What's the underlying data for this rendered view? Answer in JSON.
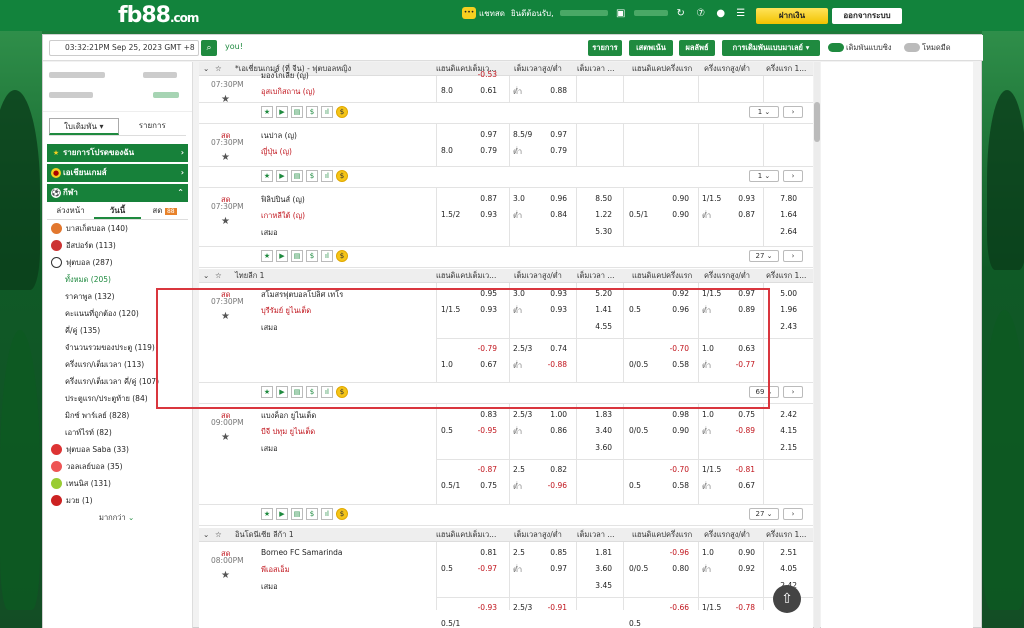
{
  "header": {
    "logo": "fb88",
    "logo_suffix": ".com",
    "chat_label": "แชทสด",
    "welcome": "ยินดีต้อนรับ,",
    "deposit_label": "ฝากเงิน",
    "logout_label": "ออกจากระบบ"
  },
  "toolbar": {
    "datetime": "03:32:21PM Sep 25, 2023 GMT +8",
    "search_text": "you!",
    "btn_items": "รายการ",
    "btn_hot": "เสตพเน้น",
    "btn_results": "ผลลัพธ์",
    "btn_type": "การเดิมพันแบบมาเลย์",
    "toggle1_label": "เดิมพันแบบซิง",
    "toggle2_label": "โหมดมืด"
  },
  "sidebar": {
    "tab_betslip": "ใบเดิมพัน",
    "tab_list": "รายการ",
    "sections": [
      {
        "label": "รายการโปรดของฉัน"
      },
      {
        "label": "เอเชียนเกมส์"
      },
      {
        "label": "กีฬา"
      }
    ],
    "subtabs": [
      "ล่วงหน้า",
      "วันนี้",
      "สด"
    ],
    "live_badge": "88",
    "sports": [
      {
        "label": "บาสเก็ตบอล",
        "count": "(140)"
      },
      {
        "label": "อีสปอร์ต",
        "count": "(113)"
      },
      {
        "label": "ฟุตบอล",
        "count": "(287)"
      }
    ],
    "football_sub": [
      {
        "label": "ทั้งหมด",
        "count": "(205)"
      },
      {
        "label": "ราคาพูล",
        "count": "(132)"
      },
      {
        "label": "คะแนนที่ถูกต้อง",
        "count": "(120)"
      },
      {
        "label": "คี่/คู่",
        "count": "(135)"
      },
      {
        "label": "จำนวนรวมของประตู",
        "count": "(119)"
      },
      {
        "label": "ครึ่งแรก/เต็มเวลา",
        "count": "(113)"
      },
      {
        "label": "ครึ่งแรก/เต็มเวลา คี่/คู่",
        "count": "(107)"
      },
      {
        "label": "ประตูแรก/ประตูท้าย",
        "count": "(84)"
      },
      {
        "label": "มิกซ์ พาร์เลย์",
        "count": "(828)"
      },
      {
        "label": "เอาท์ไรท์",
        "count": "(82)"
      }
    ],
    "others": [
      {
        "label": "ฟุตบอล Saba",
        "count": "(33)"
      },
      {
        "label": "วอลเลย์บอล",
        "count": "(35)"
      },
      {
        "label": "เทนนิส",
        "count": "(131)"
      },
      {
        "label": "มวย",
        "count": "(1)"
      }
    ],
    "more": "มากกว่า"
  },
  "columns": [
    "แฮนดิแคปเต็มเว...",
    "เต็มเวลาสูง/ต่ำ",
    "เต็มเวลา ...",
    "แฮนดิแคปครึ่งแรก",
    "ครึ่งแรกสูง/ต่ำ",
    "ครึ่งแรก 1..."
  ],
  "league1": "*เอเชี่ยนเกมส์ (ที่ จีน) - ฟุตบอลหญิง",
  "league2": "ไทยลีก 1",
  "league3": "อินโดนีเซีย ลีก้า 1",
  "matches": [
    {
      "time": "07:30PM",
      "live": "",
      "home": "มองโกเลีย (ญ)",
      "away": "อุสเบกิสถาน (ญ)",
      "hdp": "8.0",
      "o1": "-0.53",
      "o2": "0.61",
      "ou_label": "ต่ำ",
      "ou2": "0.88",
      "more": "1"
    },
    {
      "time": "07:30PM",
      "live": "สด",
      "home": "เนปาล (ญ)",
      "away": "ญี่ปุ่น (ญ)",
      "hdp": "8.0",
      "o1": "0.97",
      "o2": "0.79",
      "ou": "8.5/9",
      "ou1": "0.97",
      "ou_label": "ต่ำ",
      "ou2": "0.79",
      "more": "1"
    },
    {
      "time": "07:30PM",
      "live": "สด",
      "home": "ฟิลิปปินส์ (ญ)",
      "away": "เกาหลีใต้ (ญ)",
      "draw": "เสมอ",
      "hdp": "1.5/2",
      "o1": "0.87",
      "o2": "0.93",
      "ou": "3.0",
      "ou1": "0.96",
      "ou_label": "ต่ำ",
      "ou2": "0.84",
      "x1": "8.50",
      "x2": "1.22",
      "x3": "5.30",
      "h_hdp": "0.5/1",
      "h1": "0.90",
      "h2": "0.90",
      "h_ou": "1/1.5",
      "h_ou1": "0.93",
      "h_ou2": "0.87",
      "h_x1": "7.80",
      "h_x2": "1.64",
      "h_x3": "2.64",
      "more": "27"
    },
    {
      "time": "07:30PM",
      "live": "สด",
      "home": "สโมสรฟุตบอลโปลิศ เทโร",
      "away": "บุรีรัมย์ ยูไนเต็ด",
      "draw": "เสมอ",
      "hdp": "1/1.5",
      "o1": "0.95",
      "o2": "0.93",
      "ou": "3.0",
      "ou1": "0.93",
      "ou_label": "ต่ำ",
      "ou2": "0.93",
      "x1": "5.20",
      "x2": "1.41",
      "x3": "4.55",
      "h_hdp": "0.5",
      "h1": "0.92",
      "h2": "0.96",
      "h_ou": "1/1.5",
      "h_ou1": "0.97",
      "h_ou2": "0.89",
      "h_x1": "5.00",
      "h_x2": "1.96",
      "h_x3": "2.43",
      "alt_hdp": "1.0",
      "alt1": "-0.79",
      "alt2": "0.67",
      "alt_ou": "2.5/3",
      "alt_ou1": "0.74",
      "alt_ou2": "-0.88",
      "alt_h_hdp": "0/0.5",
      "alt_h1": "-0.70",
      "alt_h2": "0.58",
      "alt_h_ou": "1.0",
      "alt_h_ou1": "0.63",
      "alt_h_ou2": "-0.77",
      "more": "69"
    },
    {
      "time": "09:00PM",
      "live": "สด",
      "home": "แบงค็อก ยูไนเต็ด",
      "away": "บีจี ปทุม ยูไนเต็ด",
      "draw": "เสมอ",
      "hdp": "0.5",
      "o1": "0.83",
      "o2": "-0.95",
      "ou": "2.5/3",
      "ou1": "1.00",
      "ou_label": "ต่ำ",
      "ou2": "0.86",
      "x1": "1.83",
      "x2": "3.40",
      "x3": "3.60",
      "h_hdp": "0/0.5",
      "h1": "0.98",
      "h2": "0.90",
      "h_ou": "1.0",
      "h_ou1": "0.75",
      "h_ou2": "-0.89",
      "h_x1": "2.42",
      "h_x2": "4.15",
      "h_x3": "2.15",
      "alt_hdp": "0.5/1",
      "alt1": "-0.87",
      "alt2": "0.75",
      "alt_ou": "2.5",
      "alt_ou1": "0.82",
      "alt_ou2": "-0.96",
      "alt_h_hdp": "0.5",
      "alt_h1": "-0.70",
      "alt_h2": "0.58",
      "alt_h_ou": "1/1.5",
      "alt_h_ou1": "-0.81",
      "alt_h_ou2": "0.67",
      "more": "27"
    },
    {
      "time": "08:00PM",
      "live": "สด",
      "home": "Borneo FC Samarinda",
      "away": "พีเอสเอ็ม",
      "draw": "เสมอ",
      "hdp": "0.5",
      "o1": "0.81",
      "o2": "-0.97",
      "ou": "2.5",
      "ou1": "0.85",
      "ou_label": "ต่ำ",
      "ou2": "0.97",
      "x1": "1.81",
      "x2": "3.60",
      "x3": "3.45",
      "h_hdp": "0/0.5",
      "h1": "-0.96",
      "h2": "0.80",
      "h_ou": "1.0",
      "h_ou1": "0.90",
      "h_ou2": "0.92",
      "h_x1": "2.51",
      "h_x2": "4.05",
      "h_x3": "2.42",
      "alt_hdp": "0.5/1",
      "alt1": "-0.93",
      "alt_ou": "2.5/3",
      "alt_ou1": "-0.91",
      "alt_h_hdp": "0.5",
      "alt_h1": "-0.66",
      "alt_h_ou": "1/1.5",
      "alt_h_ou1": "-0.78"
    }
  ]
}
